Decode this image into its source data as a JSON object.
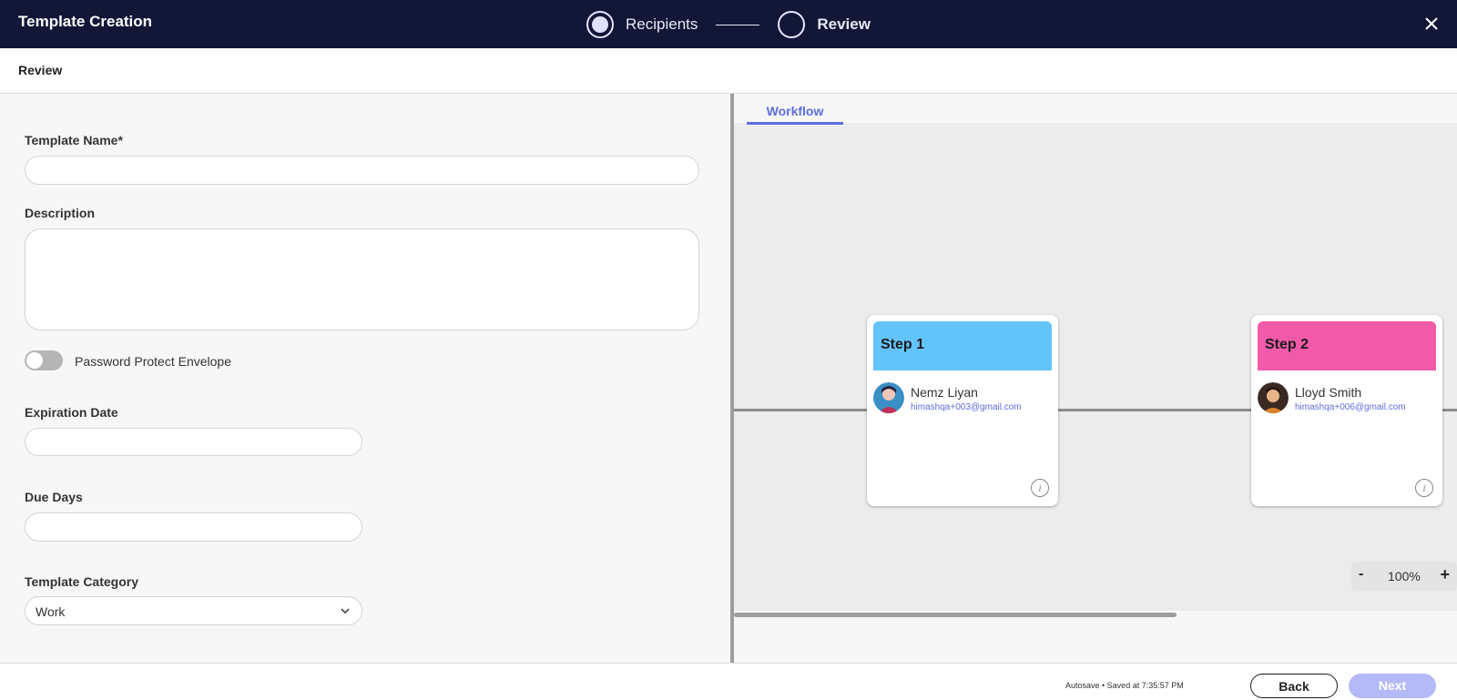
{
  "header": {
    "title": "Template Creation",
    "steps": [
      {
        "label": "Recipients",
        "active": true
      },
      {
        "label": "Review",
        "active": false
      }
    ],
    "close_icon": "close-icon"
  },
  "subheader": {
    "title": "Review"
  },
  "form": {
    "template_name_label": "Template Name*",
    "template_name_value": "",
    "description_label": "Description",
    "description_value": "",
    "password_toggle_label": "Password Protect Envelope",
    "password_toggle_on": false,
    "expiration_label": "Expiration Date",
    "expiration_value": "",
    "due_days_label": "Due Days",
    "due_days_value": "",
    "category_label": "Template Category",
    "category_value": "Work"
  },
  "workflow": {
    "tab_label": "Workflow",
    "steps": [
      {
        "title": "Step 1",
        "color": "#63c3fb",
        "recipient_name": "Nemz Liyan",
        "recipient_email": "himashqa+003@gmail.com"
      },
      {
        "title": "Step 2",
        "color": "#f15aa9",
        "recipient_name": "Lloyd Smith",
        "recipient_email": "himashqa+006@gmail.com"
      }
    ],
    "zoom": {
      "minus": "-",
      "value": "100%",
      "plus": "+"
    }
  },
  "footer": {
    "autosave": "Autosave • Saved at 7:35:57 PM",
    "back_label": "Back",
    "next_label": "Next"
  },
  "colors": {
    "header_bg": "#121737",
    "accent": "#5e6ddb",
    "next_disabled": "#b4b9f7"
  }
}
